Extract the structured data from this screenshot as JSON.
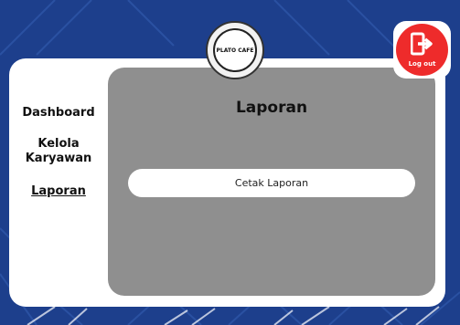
{
  "brand": {
    "logo_text": "PLATO CAFE"
  },
  "logout": {
    "label": "Log out"
  },
  "sidebar": {
    "items": [
      {
        "label": "Dashboard"
      },
      {
        "label": "Kelola\nKaryawan"
      },
      {
        "label": "Laporan"
      }
    ]
  },
  "main": {
    "title": "Laporan",
    "print_button_label": "Cetak Laporan"
  },
  "colors": {
    "background": "#1d3f8c",
    "content": "#8f8f8f",
    "logout": "#ee2b2b"
  }
}
